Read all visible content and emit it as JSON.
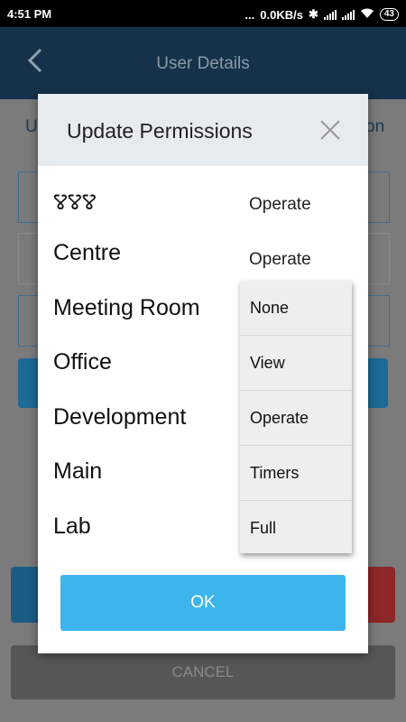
{
  "status_bar": {
    "time": "4:51 PM",
    "dots": "...",
    "network_speed": "0.0KB/s",
    "battery": "43",
    "icons": [
      "bluetooth-icon",
      "signal-icon",
      "signal-icon",
      "wifi-icon",
      "battery-icon"
    ]
  },
  "appbar": {
    "title": "User Details",
    "back_icon": "chevron-left-icon"
  },
  "background": {
    "tab_left_fragment": "U",
    "tab_right_fragment": "on",
    "cancel_label": "CANCEL"
  },
  "dialog": {
    "title": "Update Permissions",
    "close_icon": "close-icon",
    "rows": [
      {
        "name": "ꢮꢮꢮ",
        "value": "Operate"
      },
      {
        "name": "Centre",
        "value": "Operate"
      },
      {
        "name": "Meeting Room",
        "value": ""
      },
      {
        "name": "Office",
        "value": ""
      },
      {
        "name": "Development",
        "value": ""
      },
      {
        "name": "Main",
        "value": ""
      },
      {
        "name": "Lab",
        "value": ""
      }
    ],
    "dropdown_options": [
      "None",
      "View",
      "Operate",
      "Timers",
      "Full"
    ],
    "ok_label": "OK"
  },
  "colors": {
    "accent": "#3db5ec",
    "header_bg": "#e6ebf0",
    "appbar_bg": "#15324a"
  }
}
